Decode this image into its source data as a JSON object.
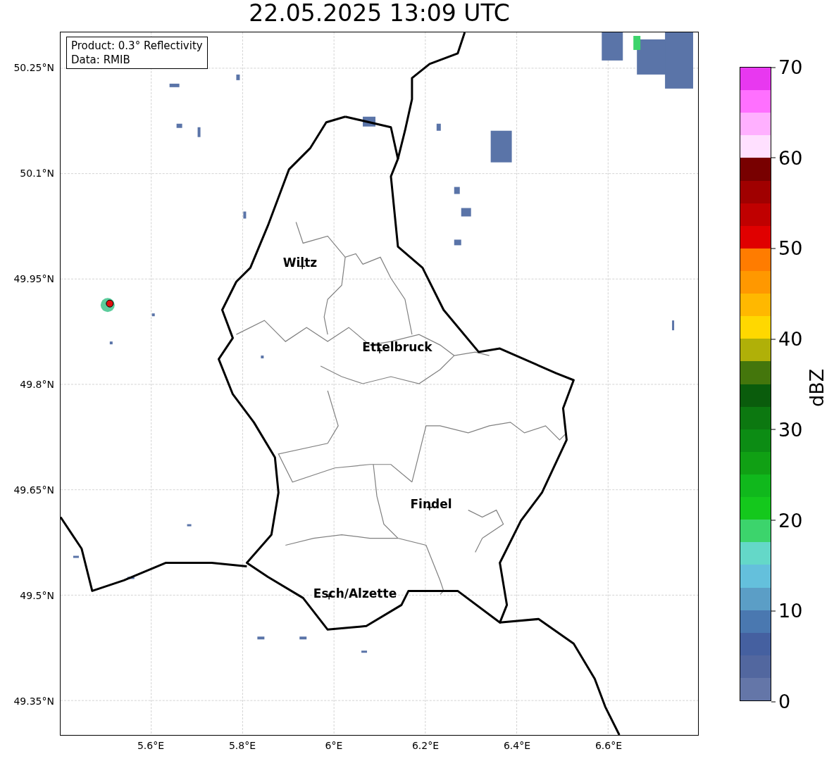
{
  "title": "22.05.2025 13:09 UTC",
  "info_box": [
    "Product: 0.3° Reflectivity",
    "Data: RMIB"
  ],
  "y_ticks": [
    "50.25°N",
    "50.1°N",
    "49.95°N",
    "49.8°N",
    "49.65°N",
    "49.5°N",
    "49.35°N"
  ],
  "x_ticks": [
    "5.6°E",
    "5.8°E",
    "6°E",
    "6.2°E",
    "6.4°E",
    "6.6°E"
  ],
  "cities": [
    {
      "name": "Wiltz"
    },
    {
      "name": "Ettelbruck"
    },
    {
      "name": "Findel"
    },
    {
      "name": "Esch/Alzette"
    }
  ],
  "colorbar": {
    "label": "dBZ",
    "ticks": [
      "70",
      "60",
      "50",
      "40",
      "30",
      "20",
      "10",
      "0"
    ],
    "bins": [
      {
        "color": "#e838f0"
      },
      {
        "color": "#ff70ff"
      },
      {
        "color": "#ffb0ff"
      },
      {
        "color": "#ffe0ff"
      },
      {
        "color": "#780000"
      },
      {
        "color": "#a00000"
      },
      {
        "color": "#c00000"
      },
      {
        "color": "#e00000"
      },
      {
        "color": "#ff7c00"
      },
      {
        "color": "#ff9800"
      },
      {
        "color": "#ffb800"
      },
      {
        "color": "#ffd800"
      },
      {
        "color": "#b0b008"
      },
      {
        "color": "#44760c"
      },
      {
        "color": "#0a5c0c"
      },
      {
        "color": "#0c7810"
      },
      {
        "color": "#0c8c14"
      },
      {
        "color": "#10a014"
      },
      {
        "color": "#10b81c"
      },
      {
        "color": "#14c81c"
      },
      {
        "color": "#3cd46c"
      },
      {
        "color": "#64d8c8"
      },
      {
        "color": "#64c0dc"
      },
      {
        "color": "#5b9ec6"
      },
      {
        "color": "#4a78b0"
      },
      {
        "color": "#4560a0"
      },
      {
        "color": "#52679f"
      },
      {
        "color": "#6476a8"
      }
    ]
  }
}
